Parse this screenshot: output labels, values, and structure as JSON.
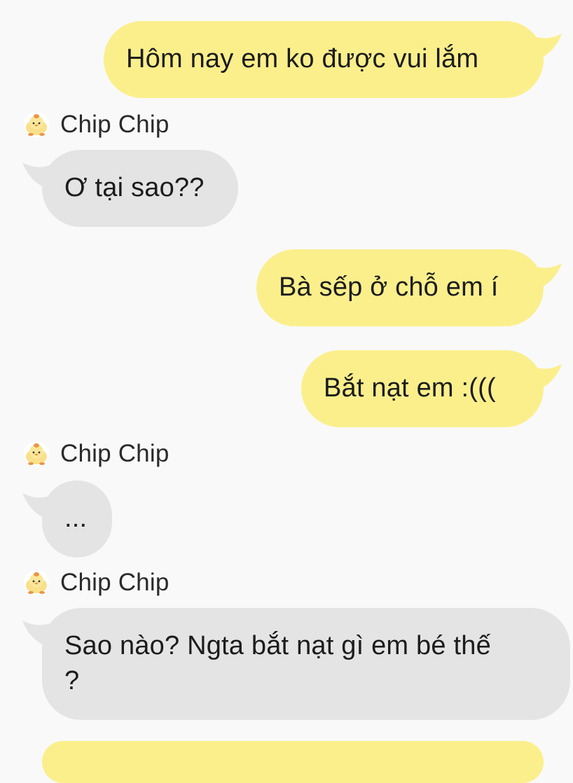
{
  "colors": {
    "background": "#f9f9f9",
    "outgoing_bubble": "#fbef8c",
    "incoming_bubble": "#e4e4e4",
    "text": "#1c1c1c"
  },
  "messages": [
    {
      "direction": "outgoing",
      "text": "Hôm nay em ko được vui lắm"
    },
    {
      "direction": "incoming",
      "sender": "Chip Chip",
      "avatar_icon": "chick-avatar-icon",
      "text": "Ơ tại sao??"
    },
    {
      "direction": "outgoing",
      "text": "Bà sếp ở chỗ em í"
    },
    {
      "direction": "outgoing",
      "text": "Bắt nạt em :((("
    },
    {
      "direction": "incoming",
      "sender": "Chip Chip",
      "avatar_icon": "chick-avatar-icon",
      "text": "..."
    },
    {
      "direction": "incoming",
      "sender": "Chip Chip",
      "avatar_icon": "chick-avatar-icon",
      "text": "Sao nào? Ngta bắt nạt gì em bé thế ?"
    }
  ]
}
